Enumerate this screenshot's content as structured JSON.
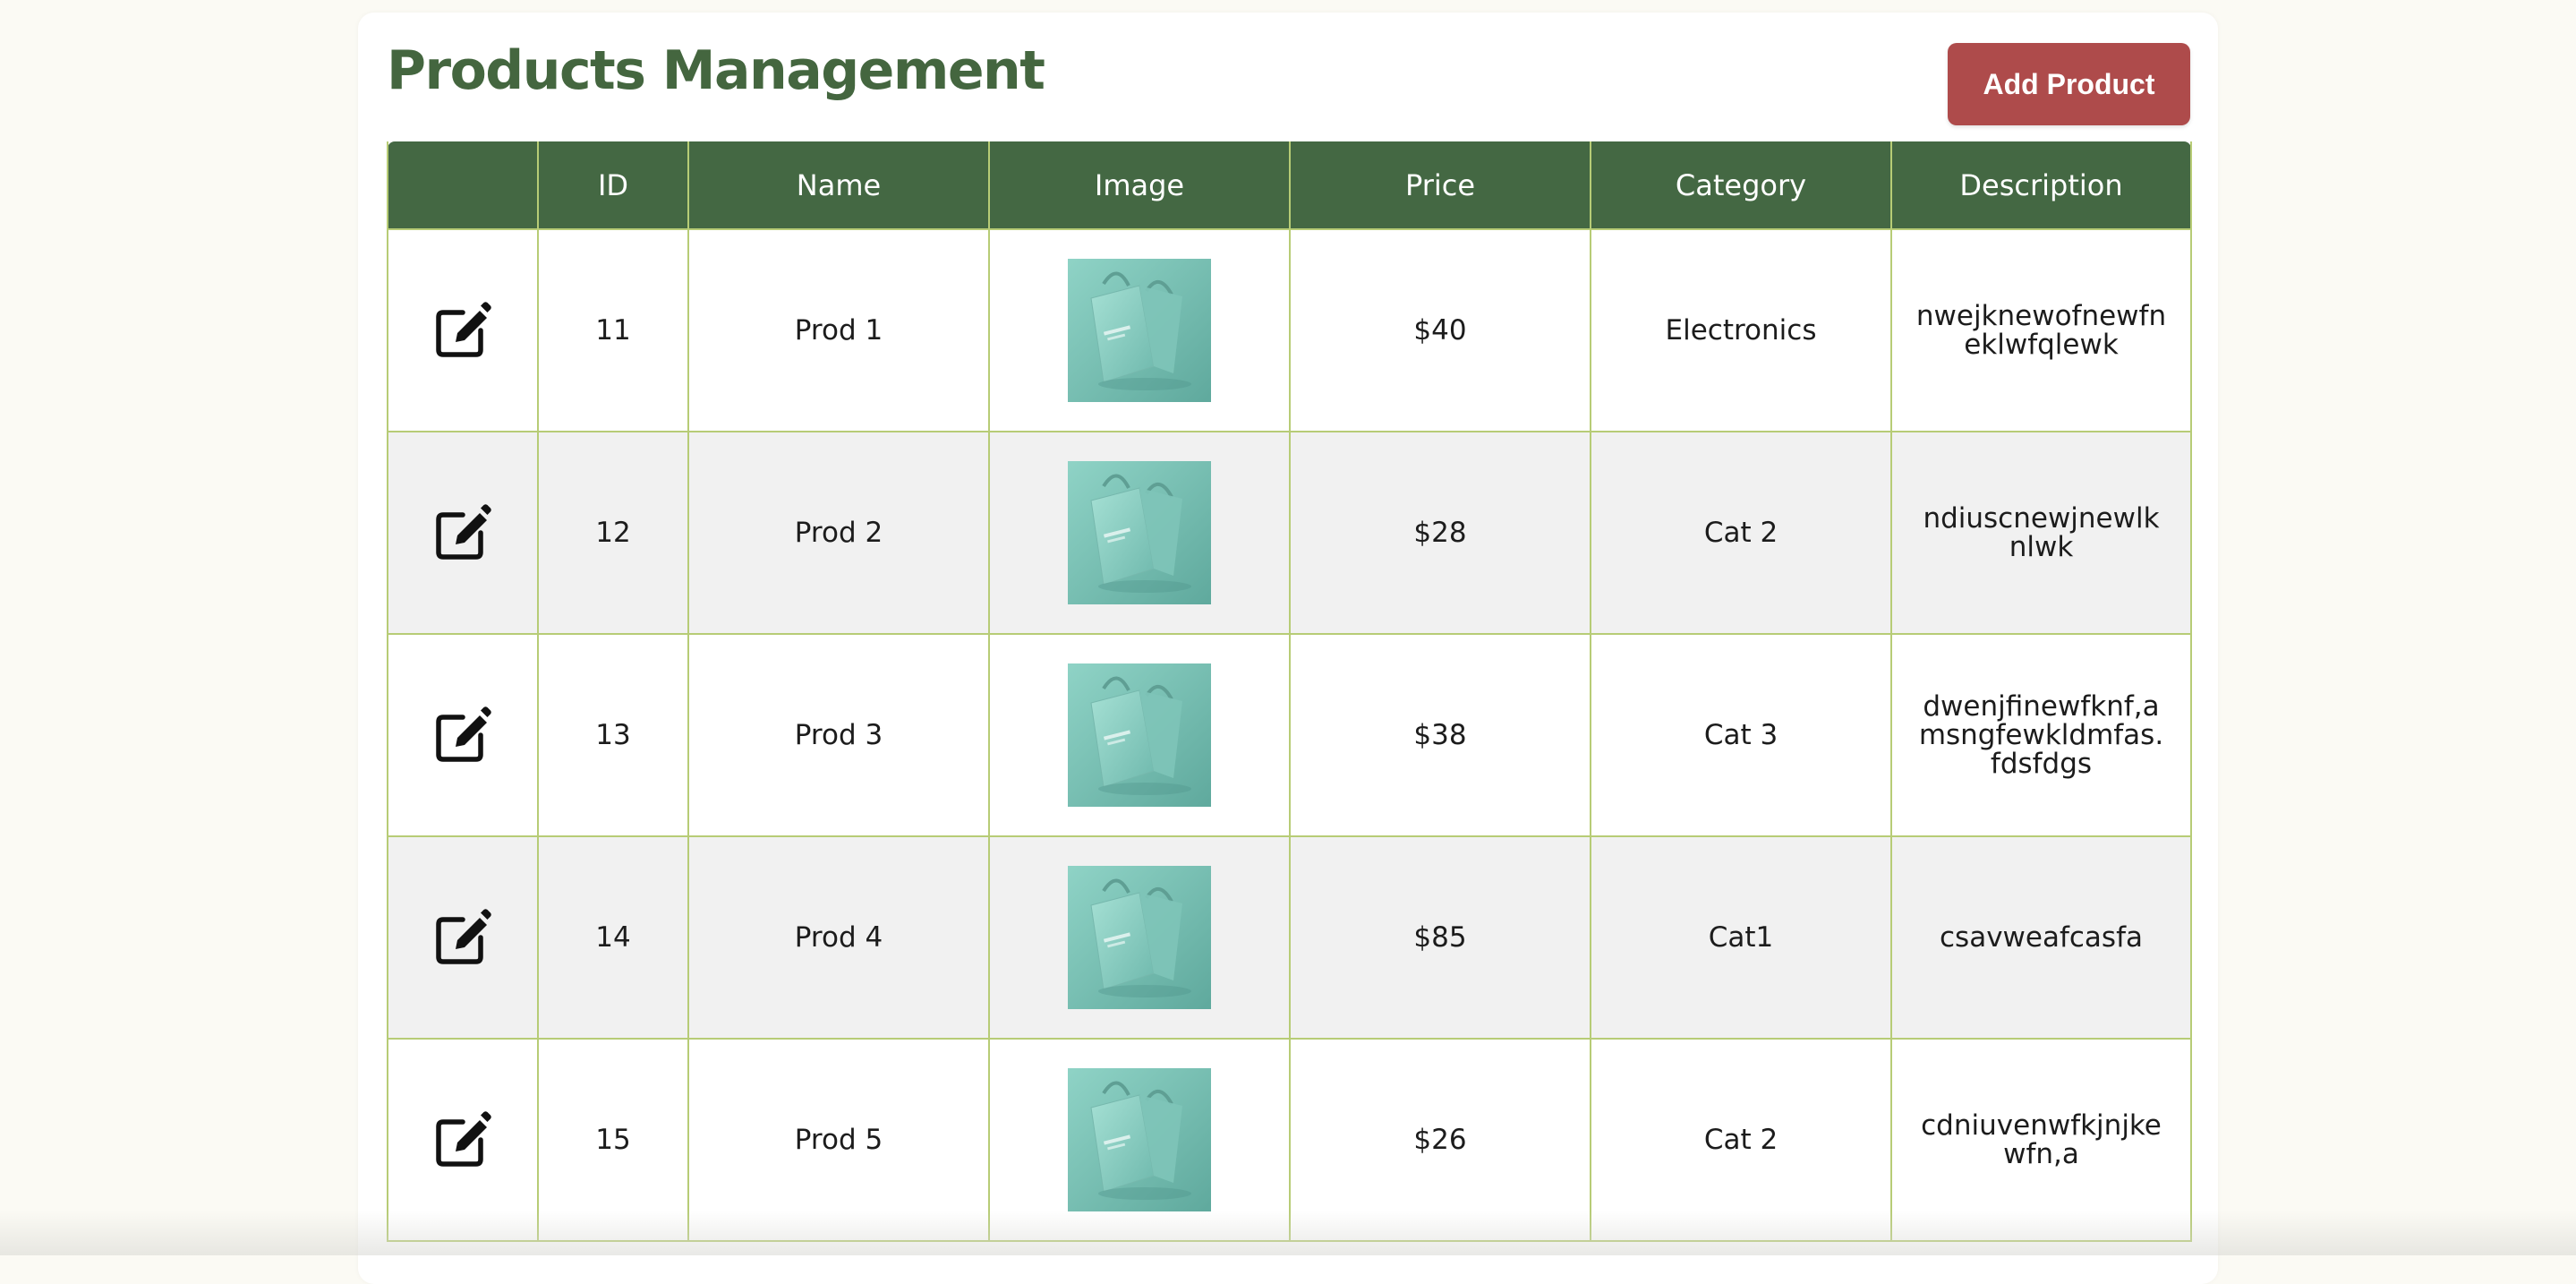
{
  "page": {
    "title": "Products Management"
  },
  "toolbar": {
    "add_label": "Add Product"
  },
  "table": {
    "columns": [
      "",
      "ID",
      "Name",
      "Image",
      "Price",
      "Category",
      "Description"
    ],
    "rows": [
      {
        "id": "11",
        "name": "Prod 1",
        "price": "$40",
        "category": "Electronics",
        "description": "nwejknewofnewfneklwfqlewk"
      },
      {
        "id": "12",
        "name": "Prod 2",
        "price": "$28",
        "category": "Cat 2",
        "description": "ndiuscnewjnewlknlwk"
      },
      {
        "id": "13",
        "name": "Prod 3",
        "price": "$38",
        "category": "Cat 3",
        "description": "dwenjfinewfknf,amsngfewkldmfas.fdsfdgs"
      },
      {
        "id": "14",
        "name": "Prod 4",
        "price": "$85",
        "category": "Cat1",
        "description": "csavweafcasfa"
      },
      {
        "id": "15",
        "name": "Prod 5",
        "price": "$26",
        "category": "Cat 2",
        "description": "cdniuvenwfkjnjkewfn,a"
      }
    ]
  },
  "icons": {
    "edit": "edit-icon",
    "product_image": "tote-bag-image"
  },
  "colors": {
    "header": "#446843",
    "title": "#44663f",
    "button": "#ae4b4b",
    "border": "#b7cc76"
  }
}
